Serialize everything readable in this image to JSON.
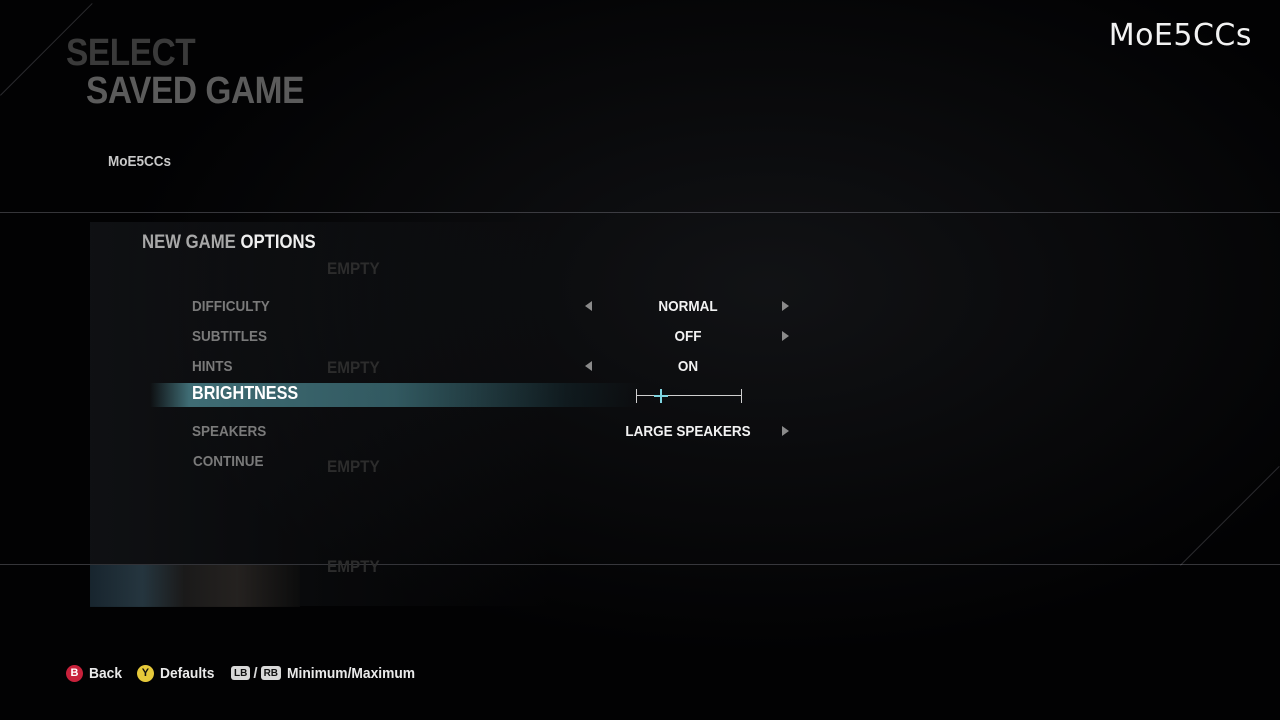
{
  "watermark": "MoE5CCs",
  "screen": {
    "title_line1": "SELECT",
    "title_line2": "SAVED GAME",
    "profile_name": "MoE5CCs"
  },
  "save_slots": [
    {
      "label": "EMPTY"
    },
    {
      "label": "EMPTY"
    },
    {
      "label": "EMPTY"
    },
    {
      "label": "EMPTY"
    }
  ],
  "panel": {
    "title_prefix": "NEW GAME",
    "title_suffix": "OPTIONS",
    "options": [
      {
        "label": "DIFFICULTY",
        "value": "NORMAL",
        "left_arrow": true,
        "right_arrow": true
      },
      {
        "label": "SUBTITLES",
        "value": "OFF",
        "left_arrow": false,
        "right_arrow": true
      },
      {
        "label": "HINTS",
        "value": "ON",
        "left_arrow": true,
        "right_arrow": false
      },
      {
        "label": "BRIGHTNESS",
        "slider_level": 0.24,
        "selected": true
      },
      {
        "label": "SPEAKERS",
        "value": "LARGE SPEAKERS",
        "left_arrow": false,
        "right_arrow": true
      },
      {
        "label": "CONTINUE"
      }
    ]
  },
  "footer": {
    "back_glyph": "B",
    "back_label": "Back",
    "defaults_glyph": "Y",
    "defaults_label": "Defaults",
    "lb_glyph": "LB",
    "rb_glyph": "RB",
    "minmax_label": "Minimum/Maximum"
  },
  "colors": {
    "highlight": "#4f8c96",
    "slider_handle": "#7fd4e0",
    "button_b": "#c8213b",
    "button_y": "#e6c93a"
  }
}
